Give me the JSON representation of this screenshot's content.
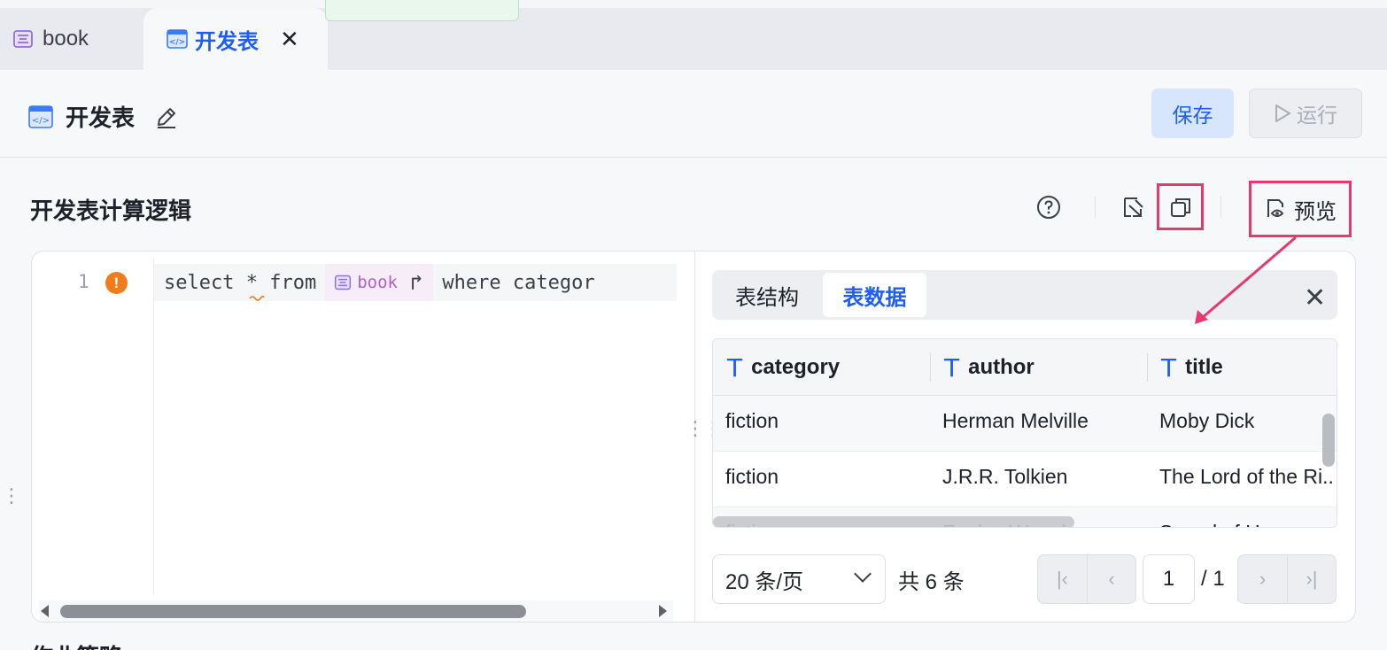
{
  "tabs": [
    {
      "label": "book",
      "icon": "table-icon",
      "active": false
    },
    {
      "label": "开发表",
      "icon": "code-table-icon",
      "active": true
    }
  ],
  "header": {
    "title": "开发表",
    "save_label": "保存",
    "run_label": "运行"
  },
  "section": {
    "title": "开发表计算逻辑",
    "preview_label": "预览",
    "bottom_title": "作业策略"
  },
  "editor": {
    "line_number": "1",
    "warning_symbol": "!",
    "code_before": "select * from",
    "table_ref": "book",
    "code_after": "where categor"
  },
  "preview": {
    "tab_structure": "表结构",
    "tab_data": "表数据",
    "columns": [
      {
        "type_icon": "T",
        "name": "category"
      },
      {
        "type_icon": "T",
        "name": "author"
      },
      {
        "type_icon": "T",
        "name": "title"
      }
    ],
    "rows": [
      [
        "fiction",
        "Herman Melville",
        "Moby Dick"
      ],
      [
        "fiction",
        "J.R.R. Tolkien",
        "The Lord of the Ri..."
      ],
      [
        "fiction",
        "Evelyn Waugh",
        "Sword of Honour"
      ]
    ],
    "pager": {
      "page_size": "20 条/页",
      "total": "共 6 条",
      "current_page": "1",
      "page_count": "/ 1"
    }
  },
  "colors": {
    "accent": "#1f5ef0",
    "highlight_box": "#e43a6d",
    "warning": "#f07c1b"
  }
}
